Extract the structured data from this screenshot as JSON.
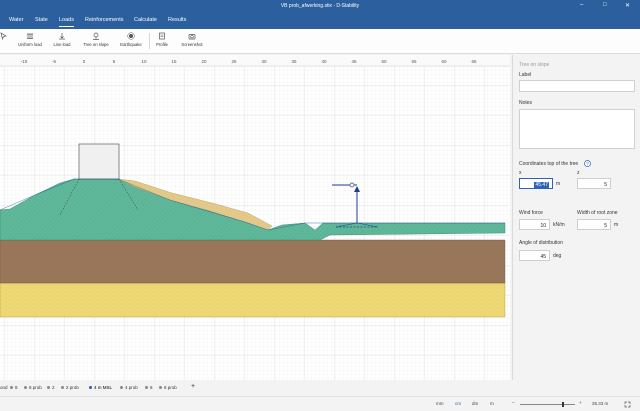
{
  "window": {
    "title": "VB prob_afwerking.stix - D-Stability"
  },
  "menu": {
    "tabs": [
      "Water",
      "State",
      "Loads",
      "Reinforcements",
      "Calculate",
      "Results"
    ],
    "active": "Loads"
  },
  "ribbon": {
    "buttons": [
      "Uniform load",
      "Line load",
      "Tree on slope",
      "Earthquake",
      "Profile",
      "Screenshot"
    ]
  },
  "canvas": {
    "ruler_ticks": [
      "-10",
      "-5",
      "0",
      "5",
      "10",
      "15",
      "20",
      "25",
      "30",
      "35",
      "40",
      "45",
      "50",
      "55",
      "60",
      "65"
    ]
  },
  "panel": {
    "heading": "Tree on slope",
    "label_caption": "Label",
    "label_value": "",
    "notes_caption": "Notes",
    "notes_value": "",
    "coords_caption": "Coordinates top of the tree",
    "x_caption": "x",
    "x_value": "45.47",
    "z_caption": "z",
    "z_value": "5",
    "x_unit": "m",
    "wind_caption": "Wind force",
    "wind_value": "10",
    "wind_unit": "kN/m",
    "root_caption": "Width of root zone",
    "root_value": "5",
    "root_unit": "m",
    "angle_caption": "Angle of distribution",
    "angle_value": "45",
    "angle_unit": "deg"
  },
  "stage_tabs": [
    "4 m MSL",
    "4 prob",
    "6",
    "6 prob"
  ],
  "stage_tabs_partial": [
    "ond",
    "8",
    "8 prob",
    "2",
    "2 prob"
  ],
  "stage_active": "4 m MSL",
  "stage_add": "+",
  "status": {
    "units": [
      "mm",
      "cm",
      "dm",
      "m"
    ],
    "active_unit": "cm",
    "zoom": "35.33 m"
  },
  "colors": {
    "accent": "#2b5f9e",
    "clay": "#9c7a5d",
    "sand": "#efd974",
    "dike": "#5fb89a",
    "top_sand": "#e2c98a"
  }
}
